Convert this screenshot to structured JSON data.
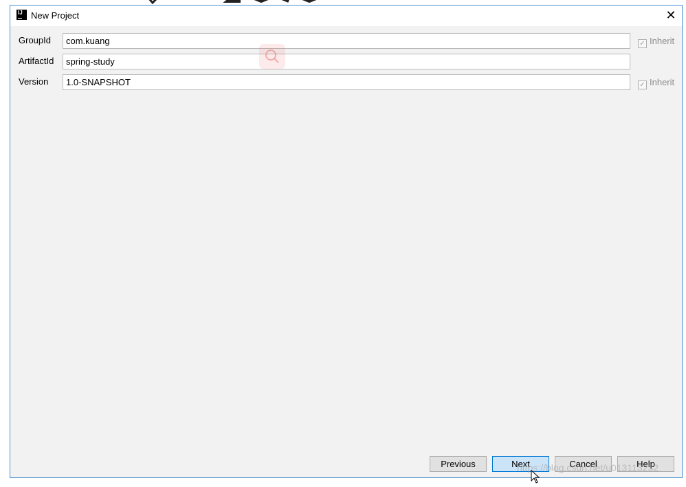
{
  "window": {
    "title": "New Project",
    "app_icon_text": "IJ",
    "close_glyph": "✕"
  },
  "form": {
    "group_id": {
      "label": "GroupId",
      "value": "com.kuang",
      "inherit_label": "Inherit",
      "inherit_checked": true
    },
    "artifact_id": {
      "label": "ArtifactId",
      "value": "spring-study"
    },
    "version": {
      "label": "Version",
      "value": "1.0-SNAPSHOT",
      "inherit_label": "Inherit",
      "inherit_checked": true
    }
  },
  "buttons": {
    "previous": "Previous",
    "next": "Next",
    "cancel": "Cancel",
    "help": "Help"
  },
  "watermark": "https://blog.csdn.net/u013113232",
  "colors": {
    "window_border": "#4a8ed1",
    "dialog_bg": "#f2f2f2",
    "primary_button_bg": "#cce4f7",
    "primary_button_border": "#0078d7"
  },
  "icons": {
    "app": "intellij-icon",
    "close": "close-icon",
    "search": "search-icon",
    "cursor": "mouse-cursor-icon"
  }
}
